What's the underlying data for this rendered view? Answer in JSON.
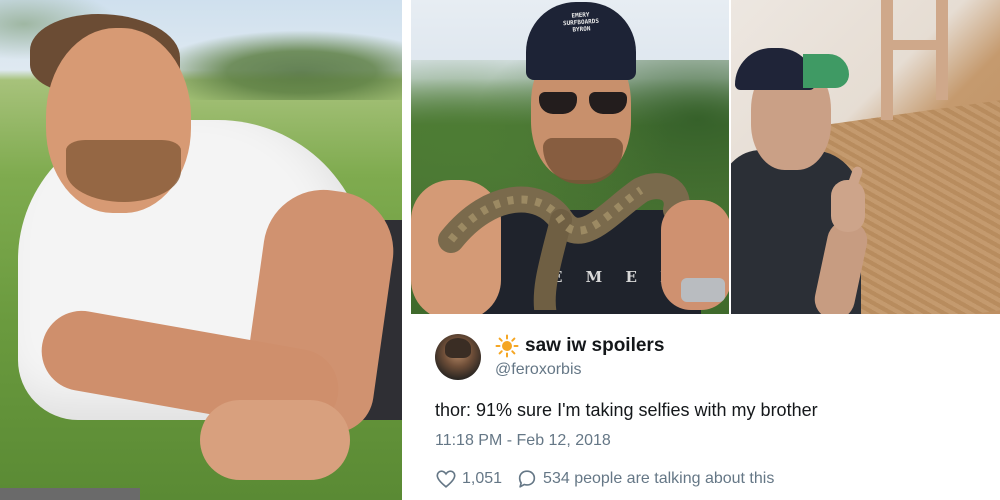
{
  "photos": {
    "left": {
      "description_icon": "photo-man-lying-on-grass"
    },
    "middle": {
      "cap_text_line1": "EMERY",
      "cap_text_line2": "SURFBOARDS",
      "cap_text_line3": "BYRON",
      "shirt_text": "E M E R Y"
    },
    "right": {
      "description_icon": "photo-man-pointing"
    }
  },
  "tweet": {
    "display_name": "saw iw spoilers",
    "display_name_icon": "sun-icon",
    "handle": "@feroxorbis",
    "text": "thor: 91% sure I'm taking selfies with my brother",
    "timestamp": "11:18 PM - Feb 12, 2018",
    "likes": "1,051",
    "replies_text": "534 people are talking about this",
    "colors": {
      "name": "#14171a",
      "secondary": "#657786",
      "sun": "#f5a623"
    }
  }
}
